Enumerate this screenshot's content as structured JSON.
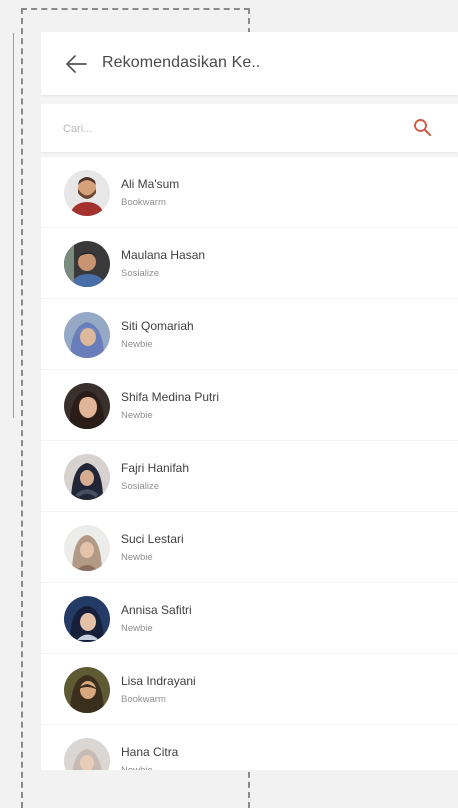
{
  "header": {
    "title": "Rekomendasikan Ke..",
    "back_icon": "arrow-left-icon"
  },
  "search": {
    "placeholder": "Cari...",
    "value": "",
    "icon": "search-icon",
    "icon_color": "#d05a43"
  },
  "users": [
    {
      "name": "Ali Ma'sum",
      "role": "Bookwarm"
    },
    {
      "name": "Maulana Hasan",
      "role": "Sosialize"
    },
    {
      "name": "Siti Qomariah",
      "role": "Newbie"
    },
    {
      "name": "Shifa Medina Putri",
      "role": "Newbie"
    },
    {
      "name": "Fajri Hanifah",
      "role": "Sosialize"
    },
    {
      "name": "Suci Lestari",
      "role": "Newbie"
    },
    {
      "name": "Annisa Safitri",
      "role": "Newbie"
    },
    {
      "name": "Lisa Indrayani",
      "role": "Bookwarm"
    },
    {
      "name": "Hana Citra",
      "role": "Newbie"
    }
  ],
  "colors": {
    "page_background": "#f2f2f2",
    "card_background": "#ffffff",
    "accent": "#d05a43",
    "text_primary": "#3f3f3f",
    "text_secondary": "#8f8f8f"
  }
}
